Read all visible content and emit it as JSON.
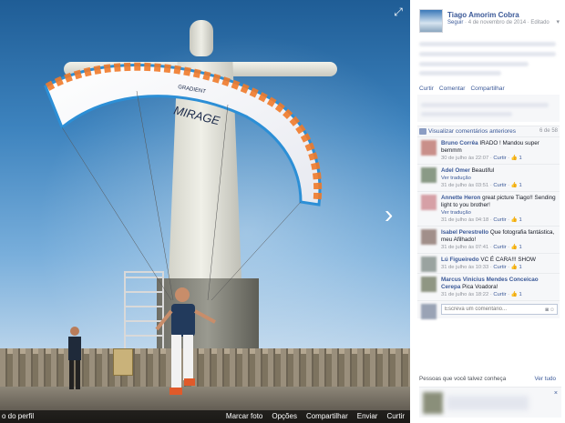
{
  "photo": {
    "wing_text": "MIRAGE",
    "wing_brand": "GRADIENT"
  },
  "photo_bar": {
    "profile_link": "o do perfil",
    "actions": [
      "Marcar foto",
      "Opções",
      "Compartilhar",
      "Enviar",
      "Curtir"
    ]
  },
  "post": {
    "author": "Tiago Amorim Cobra",
    "follow": "Seguir",
    "date": "4 de novembro de 2014",
    "edited": "Editado",
    "actions": [
      "Curtir",
      "Comentar",
      "Compartilhar"
    ]
  },
  "prev_comments": {
    "label": "Visualizar comentários anteriores",
    "count": "6 de 58"
  },
  "comments": [
    {
      "name": "Bruno Corrêa",
      "text": "IRADO ! Mandou super bemmm",
      "time": "30 de julho às 22:07",
      "like": "Curtir",
      "likes": "1",
      "avatar": "#c98f8a",
      "translate": ""
    },
    {
      "name": "Adel Omer",
      "text": "Beautiful",
      "time": "31 de julho às 03:51",
      "like": "Curtir",
      "likes": "1",
      "avatar": "#8a9a86",
      "translate": "Ver tradução"
    },
    {
      "name": "Annette Heron",
      "text": "great picture Tiago!! Sending light to you brother!",
      "time": "31 de julho às 04:18",
      "like": "Curtir",
      "likes": "1",
      "avatar": "#d6a0a6",
      "translate": "Ver tradução"
    },
    {
      "name": "Isabel Perestrello",
      "text": "Que fotografia fantástica, meu Afilhado!",
      "time": "31 de julho às 07:41",
      "like": "Curtir",
      "likes": "1",
      "avatar": "#a18f8a",
      "translate": ""
    },
    {
      "name": "Lú Figueiredo",
      "text": "VC É CARA!!! SHOW",
      "time": "31 de julho às 10:33",
      "like": "Curtir",
      "likes": "1",
      "avatar": "#9aa3a0",
      "translate": ""
    },
    {
      "name": "Marcus Vinicius Mendes Conceicao Cerepa",
      "text": "Pica Voadora!",
      "time": "31 de julho às 18:22",
      "like": "Curtir",
      "likes": "1",
      "avatar": "#8f9683",
      "translate": ""
    }
  ],
  "comment_input": {
    "placeholder": "Escreva um comentário..."
  },
  "people": {
    "title": "Pessoas que você talvez conheça",
    "see_all": "Ver tudo",
    "close": "×"
  },
  "colors": {
    "link": "#3b5998",
    "wing_orange": "#f07a2a",
    "wing_blue": "#2c8fd6"
  }
}
